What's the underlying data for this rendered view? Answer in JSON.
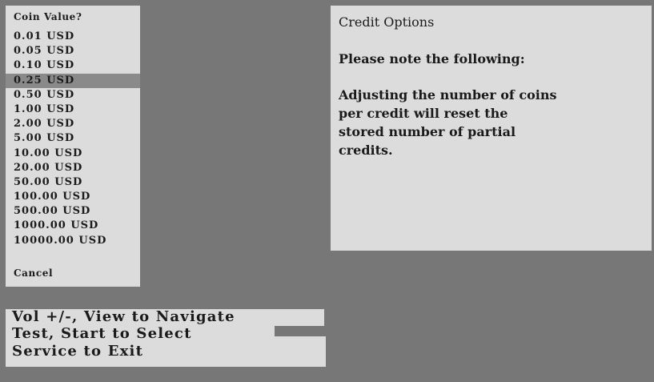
{
  "coin_menu": {
    "title": "Coin Value?",
    "options": [
      "0.01 USD",
      "0.05 USD",
      "0.10 USD",
      "0.25 USD",
      "0.50 USD",
      "1.00 USD",
      "2.00 USD",
      "5.00 USD",
      "10.00 USD",
      "20.00 USD",
      "50.00 USD",
      "100.00 USD",
      "500.00 USD",
      "1000.00 USD",
      "10000.00 USD"
    ],
    "selected_index": 3,
    "cancel_label": "Cancel"
  },
  "info_panel": {
    "title": "Credit Options",
    "note": "Please note the following:",
    "body_lines": [
      "Adjusting the number of coins",
      "per credit will reset the",
      "stored number of partial",
      "credits."
    ]
  },
  "instructions": {
    "line1": "Vol +/-, View to Navigate",
    "line2": "Test, Start to Select",
    "line3": "Service to Exit"
  },
  "colors": {
    "background": "#777777",
    "panel": "#dcdcdc",
    "selected_row": "#8a8a8a",
    "text": "#1a1a1a"
  }
}
